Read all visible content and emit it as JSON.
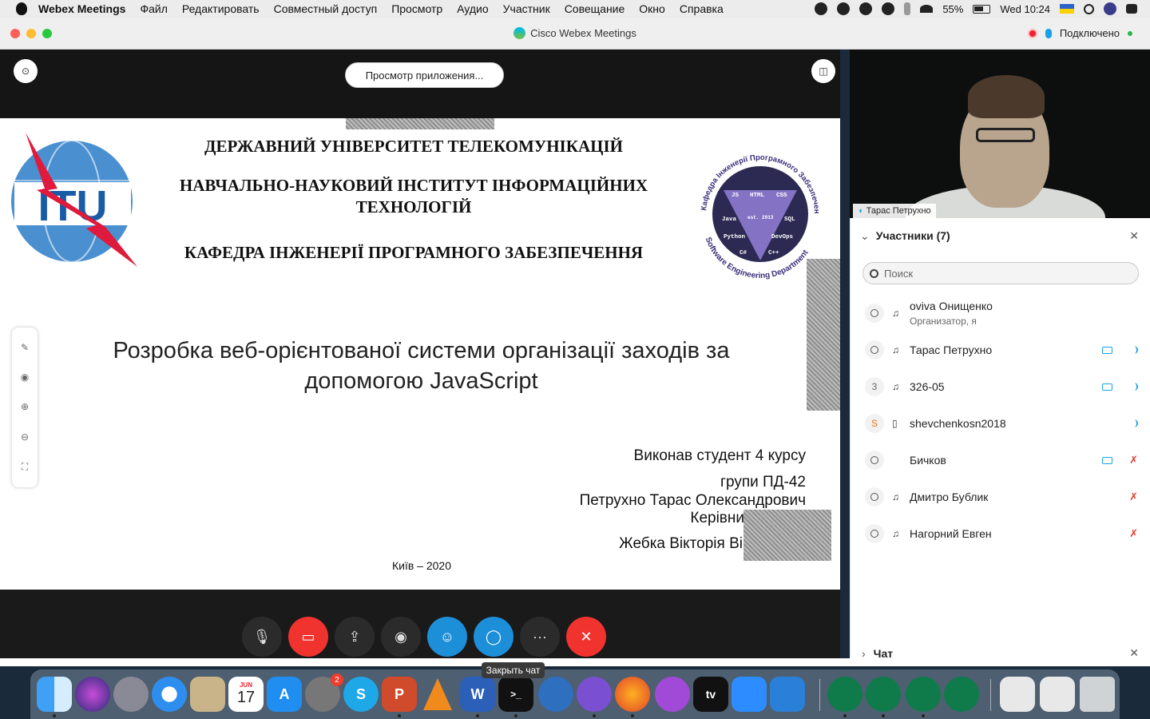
{
  "menubar": {
    "app": "Webex Meetings",
    "items": [
      "Файл",
      "Редактировать",
      "Совместный доступ",
      "Просмотр",
      "Аудио",
      "Участник",
      "Совещание",
      "Окно",
      "Справка"
    ],
    "battery": "55%",
    "clock": "Wed 10:24"
  },
  "window": {
    "title": "Cisco Webex Meetings",
    "status": "Подключено"
  },
  "stage": {
    "view_app_button": "Просмотр приложения..."
  },
  "slide": {
    "header_line1": "ДЕРЖАВНИЙ УНІВЕРСИТЕТ ТЕЛЕКОМУНІКАЦІЙ",
    "header_line2a": "НАВЧАЛЬНО-НАУКОВИЙ ІНСТИТУТ ІНФОРМАЦІЙНИХ",
    "header_line2b": "ТЕХНОЛОГІЙ",
    "header_line3": "КАФЕДРА ІНЖЕНЕРІЇ ПРОГРАМНОГО ЗАБЕЗПЕЧЕННЯ",
    "itu_logo_text": "ITU",
    "dept_logo": {
      "ring_top": "Кафедра Інженерії Програмного Забезпечення",
      "ring_bottom": "Software Engineering Department",
      "tags": [
        "JS",
        "HTML",
        "CSS",
        "Java",
        "est. 2013",
        "SQL",
        "Python",
        "DevOps",
        "C#",
        "C++"
      ]
    },
    "title_line1": "Розробка веб-орієнтованої системи організації заходів за",
    "title_line2": "допомогою JavaScript",
    "author_line1": "Виконав  студент 4 курсу",
    "author_line2": "групи ПД-42",
    "author_line3": "Петрухно Тарас Олександрович",
    "author_line4": "Керівни",
    "author_line5": "Жебка Вікторія Ві",
    "city": "Київ – 2020"
  },
  "video": {
    "label": "Тарас Петрухно"
  },
  "participants": {
    "header": "Участники (7)",
    "search_placeholder": "Поиск",
    "list": [
      {
        "name": "oviva Онищенко",
        "sub": "Организатор, я",
        "avatar": "",
        "video": false,
        "audio": "none"
      },
      {
        "name": "Тарас Петрухно",
        "sub": "",
        "avatar": "",
        "video": true,
        "audio": "on"
      },
      {
        "name": "326-05",
        "sub": "",
        "avatar": "3",
        "video": true,
        "audio": "on"
      },
      {
        "name": "shevchenkosn2018",
        "sub": "",
        "avatar": "S",
        "video": false,
        "audio": "on"
      },
      {
        "name": "Бичков",
        "sub": "",
        "avatar": "",
        "video": true,
        "audio": "muted"
      },
      {
        "name": "Дмитро Бублик",
        "sub": "",
        "avatar": "",
        "video": false,
        "audio": "muted"
      },
      {
        "name": "Нагорний Евген",
        "sub": "",
        "avatar": "",
        "video": false,
        "audio": "muted"
      }
    ]
  },
  "chat": {
    "header": "Чат"
  },
  "dock": {
    "tooltip": "Закрыть чат",
    "settings_badge": "2",
    "calendar_month": "JUN",
    "calendar_day": "17",
    "tv_label": "tv"
  }
}
